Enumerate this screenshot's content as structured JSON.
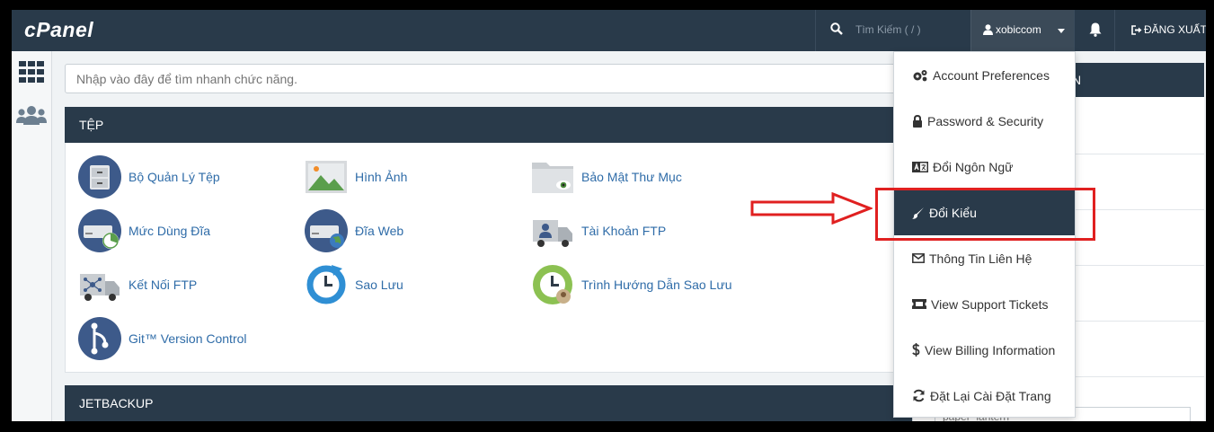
{
  "app": {
    "logo": "cPanel"
  },
  "topbar": {
    "search_placeholder": "Tìm Kiếm ( / )",
    "username": "xobiccom",
    "logout_label": "ĐĂNG XUẤT"
  },
  "quick_search": {
    "placeholder": "Nhập vào đây để tìm nhanh chức năng."
  },
  "files_section": {
    "title": "TỆP",
    "items": [
      {
        "label": "Bộ Quản Lý Tệp",
        "icon": "file-manager-icon"
      },
      {
        "label": "Hình Ảnh",
        "icon": "images-icon"
      },
      {
        "label": "Bảo Mật Thư Mục",
        "icon": "directory-privacy-icon"
      },
      {
        "label": "Mức Dùng Đĩa",
        "icon": "disk-usage-icon"
      },
      {
        "label": "Đĩa Web",
        "icon": "web-disk-icon"
      },
      {
        "label": "Tài Khoản FTP",
        "icon": "ftp-accounts-icon"
      },
      {
        "label": "Kết Nối FTP",
        "icon": "ftp-connections-icon"
      },
      {
        "label": "Sao Lưu",
        "icon": "backup-icon"
      },
      {
        "label": "Trình Hướng Dẫn Sao Lưu",
        "icon": "backup-wizard-icon"
      },
      {
        "label": "Git™ Version Control",
        "icon": "git-icon"
      }
    ]
  },
  "jetbackup_section": {
    "title": "JETBACKUP"
  },
  "right_panel": {
    "title_fragment": "N",
    "select_value": "paper_lantern"
  },
  "user_menu": {
    "items": [
      {
        "label": "Account Preferences",
        "icon": "gears-icon"
      },
      {
        "label": "Password & Security",
        "icon": "lock-icon"
      },
      {
        "label": "Đổi Ngôn Ngữ",
        "icon": "language-icon"
      },
      {
        "label": "Đổi Kiểu",
        "icon": "brush-icon",
        "active": true
      },
      {
        "label": "Thông Tin Liên Hệ",
        "icon": "envelope-icon"
      },
      {
        "label": "View Support Tickets",
        "icon": "ticket-icon"
      },
      {
        "label": "View Billing Information",
        "icon": "dollar-icon"
      },
      {
        "label": "Đặt Lại Cài Đặt Trang",
        "icon": "refresh-icon"
      }
    ]
  },
  "colors": {
    "topbar": "#293a4a",
    "link": "#2f6ca8",
    "highlight": "#e02020"
  }
}
